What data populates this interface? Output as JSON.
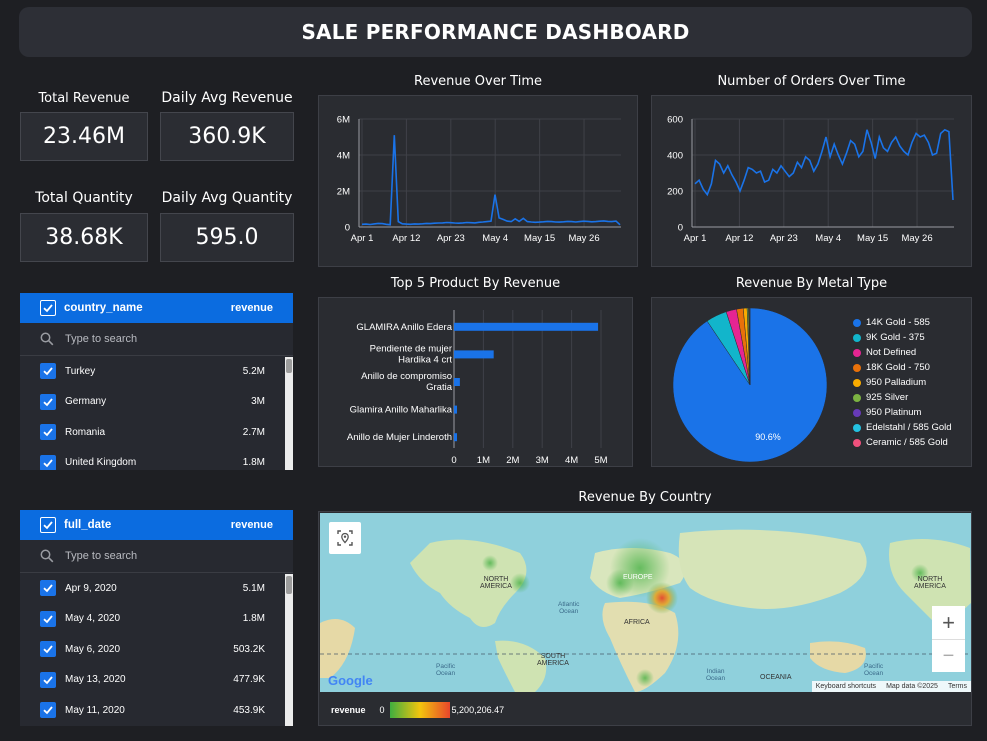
{
  "title": "SALE PERFORMANCE DASHBOARD",
  "kpis": {
    "total_revenue": {
      "label": "Total Revenue",
      "value": "23.46M"
    },
    "daily_avg_revenue": {
      "label": "Daily Avg Revenue",
      "value": "360.9K"
    },
    "total_quantity": {
      "label": "Total Quantity",
      "value": "38.68K"
    },
    "daily_avg_quantity": {
      "label": "Daily Avg Quantity",
      "value": "595.0"
    }
  },
  "country_table": {
    "dimension": "country_name",
    "metric": "revenue",
    "search_placeholder": "Type to search",
    "rows": [
      {
        "name": "Turkey",
        "value": "5.2M"
      },
      {
        "name": "Germany",
        "value": "3M"
      },
      {
        "name": "Romania",
        "value": "2.7M"
      },
      {
        "name": "United Kingdom",
        "value": "1.8M"
      }
    ]
  },
  "date_table": {
    "dimension": "full_date",
    "metric": "revenue",
    "search_placeholder": "Type to search",
    "rows": [
      {
        "name": "Apr 9, 2020",
        "value": "5.1M"
      },
      {
        "name": "May 4, 2020",
        "value": "1.8M"
      },
      {
        "name": "May 6, 2020",
        "value": "503.2K"
      },
      {
        "name": "May 13, 2020",
        "value": "477.9K"
      },
      {
        "name": "May 11, 2020",
        "value": "453.9K"
      }
    ]
  },
  "chart_data": [
    {
      "type": "line",
      "title": "Revenue Over Time",
      "x_ticks": [
        "Apr 1",
        "Apr 12",
        "Apr 23",
        "May 4",
        "May 15",
        "May 26"
      ],
      "y_ticks": [
        "0",
        "2M",
        "4M",
        "6M"
      ],
      "ylim": [
        0,
        6000000
      ],
      "x_range": [
        "2020-04-01",
        "2020-06-04"
      ],
      "series": [
        {
          "values": [
            150000,
            160000,
            140000,
            170000,
            200000,
            190000,
            150000,
            130000,
            5100000,
            300000,
            180000,
            160000,
            150000,
            170000,
            160000,
            180000,
            200000,
            190000,
            210000,
            220000,
            230000,
            250000,
            240000,
            220000,
            210000,
            230000,
            250000,
            240000,
            230000,
            260000,
            280000,
            300000,
            320000,
            1800000,
            503200,
            420000,
            330000,
            300000,
            453900,
            310000,
            477900,
            300000,
            280000,
            260000,
            270000,
            290000,
            310000,
            300000,
            280000,
            270000,
            290000,
            310000,
            300000,
            280000,
            300000,
            320000,
            310000,
            290000,
            300000,
            320000,
            340000,
            310000,
            300000,
            330000,
            120000
          ]
        }
      ]
    },
    {
      "type": "line",
      "title": "Number of Orders Over Time",
      "x_ticks": [
        "Apr 1",
        "Apr 12",
        "Apr 23",
        "May 4",
        "May 15",
        "May 26"
      ],
      "y_ticks": [
        "0",
        "200",
        "400",
        "600"
      ],
      "ylim": [
        0,
        600
      ],
      "x_range": [
        "2020-04-01",
        "2020-06-04"
      ],
      "series": [
        {
          "values": [
            240,
            260,
            210,
            180,
            240,
            370,
            350,
            300,
            340,
            290,
            250,
            200,
            260,
            330,
            320,
            300,
            310,
            250,
            260,
            320,
            300,
            340,
            310,
            280,
            300,
            360,
            330,
            390,
            370,
            310,
            350,
            420,
            500,
            390,
            460,
            400,
            350,
            410,
            480,
            460,
            390,
            420,
            540,
            470,
            380,
            500,
            440,
            420,
            470,
            500,
            450,
            420,
            400,
            470,
            520,
            500,
            510,
            470,
            400,
            410,
            520,
            540,
            530,
            150
          ]
        }
      ]
    },
    {
      "type": "bar",
      "orientation": "horizontal",
      "title": "Top 5 Product By Revenue",
      "categories": [
        "GLAMIRA Anillo Edera",
        "Pendiente de mujer Hardika 4 crt",
        "Anillo de compromiso Gratia",
        "Glamira Anillo Maharlika",
        "Anillo de Mujer Linderoth"
      ],
      "values": [
        4900000,
        1350000,
        200000,
        100000,
        70000
      ],
      "x_ticks": [
        "0",
        "1M",
        "2M",
        "3M",
        "4M",
        "5M"
      ],
      "xlim": [
        0,
        5000000
      ]
    },
    {
      "type": "pie",
      "title": "Revenue By Metal Type",
      "labels": [
        "14K Gold - 585",
        "9K Gold - 375",
        "Not Defined",
        "18K Gold - 750",
        "950 Palladium",
        "925 Silver",
        "950 Platinum",
        "Edelstahl / 585 Gold",
        "Ceramic / 585 Gold"
      ],
      "values": [
        90.6,
        4.4,
        2.2,
        1.4,
        0.8,
        0.3,
        0.1,
        0.1,
        0.1
      ],
      "colors": [
        "#1a73e8",
        "#12b5cb",
        "#e52592",
        "#e8710a",
        "#f9ab00",
        "#7cb342",
        "#673ab7",
        "#24c1e0",
        "#f0517d"
      ],
      "slice_label": "90.6%",
      "legend": "right"
    }
  ],
  "map": {
    "title": "Revenue By Country",
    "labels": {
      "north_america_left": "NORTH\nAMERICA",
      "north_america_right": "NORTH\nAMERICA",
      "europe": "EUROPE",
      "africa": "AFRICA",
      "south_america": "SOUTH\nAMERICA",
      "atlantic": "Atlantic\nOcean",
      "pacific_left": "Pacific\nOcean",
      "pacific_right": "Pacific\nOcean",
      "indian": "Indian\nOcean",
      "oceania": "OCEANIA"
    },
    "attribution": [
      "Keyboard shortcuts",
      "Map data ©2025",
      "Terms"
    ],
    "logo": "Google",
    "legend": {
      "metric": "revenue",
      "min": "0",
      "max": "5,200,206.47"
    },
    "zoom_in": "+",
    "zoom_out": "−"
  },
  "colors": {
    "accent": "#1a73e8",
    "background": "#1e1f23",
    "panel": "#2a2c31",
    "header_blue": "#0b6ce0"
  }
}
